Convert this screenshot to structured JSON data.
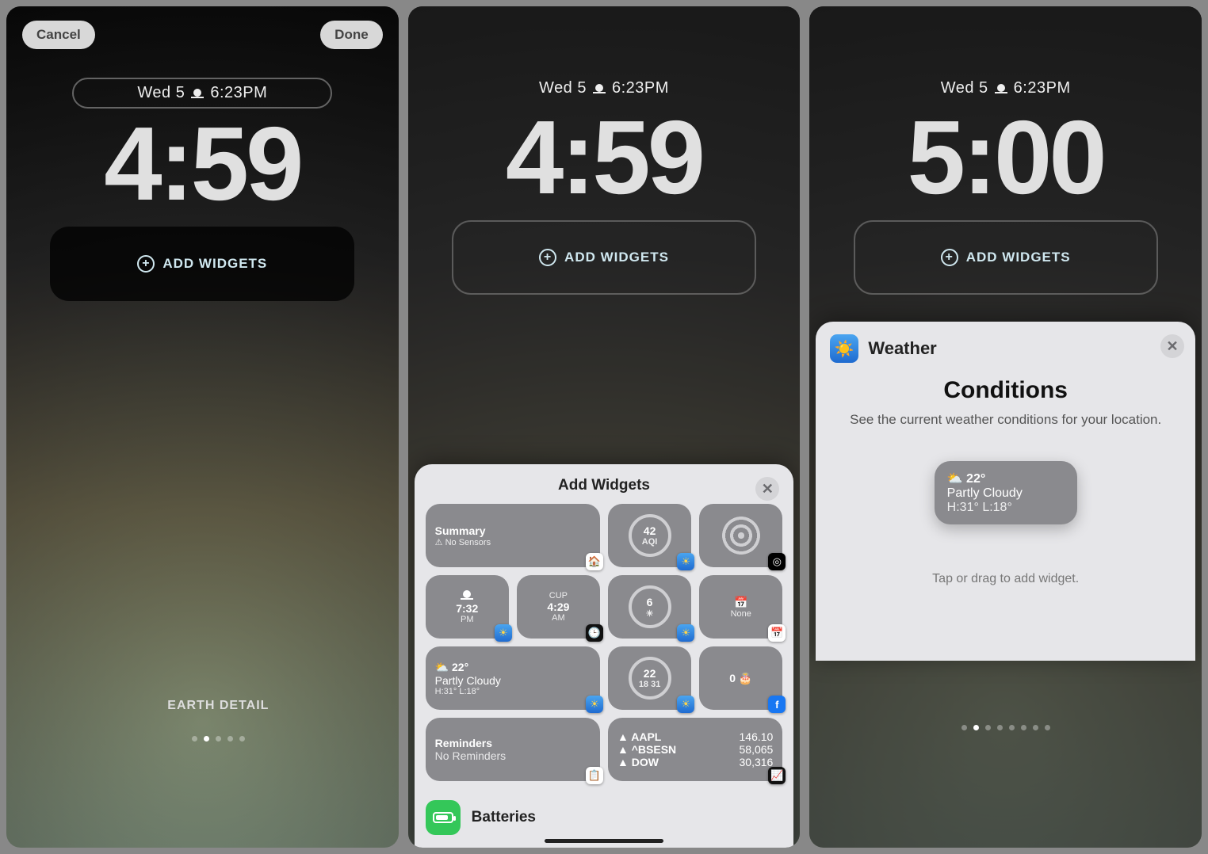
{
  "panel1": {
    "cancel": "Cancel",
    "done": "Done",
    "date": "Wed 5",
    "time_small": "6:23PM",
    "clock": "4:59",
    "add_widgets": "ADD WIDGETS",
    "wallpaper_name": "EARTH DETAIL"
  },
  "panel2": {
    "date": "Wed 5",
    "time_small": "6:23PM",
    "clock": "4:59",
    "add_widgets": "ADD WIDGETS",
    "sheet_title": "Add Widgets",
    "widgets": {
      "summary_title": "Summary",
      "summary_sub": "No Sensors",
      "aqi_value": "42",
      "aqi_label": "AQI",
      "sunset_time": "7:32",
      "sunset_ampm": "PM",
      "cup_label": "CUP",
      "cup_time": "4:29",
      "cup_ampm": "AM",
      "uv_value": "6",
      "cal_none": "None",
      "weather_temp": "22°",
      "weather_cond": "Partly Cloudy",
      "weather_hilo": "H:31° L:18°",
      "moon_value": "22",
      "moon_sub": "18  31",
      "birthday_count": "0",
      "reminders_title": "Reminders",
      "reminders_sub": "No Reminders",
      "stock1_sym": "▲ AAPL",
      "stock1_val": "146.10",
      "stock2_sym": "▲ ^BSESN",
      "stock2_val": "58,065",
      "stock3_sym": "▲ DOW",
      "stock3_val": "30,316"
    },
    "app_row_label": "Batteries"
  },
  "panel3": {
    "date": "Wed 5",
    "time_small": "6:23PM",
    "clock": "5:00",
    "add_widgets": "ADD WIDGETS",
    "sheet_app": "Weather",
    "heading": "Conditions",
    "desc": "See the current weather conditions for your location.",
    "preview_temp": "22°",
    "preview_cond": "Partly Cloudy",
    "preview_hilo": "H:31° L:18°",
    "hint": "Tap or drag to add widget."
  }
}
